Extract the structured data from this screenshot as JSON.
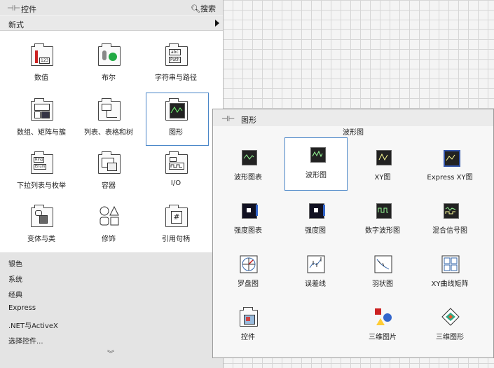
{
  "controls_palette": {
    "title": "控件",
    "search_label": "搜索",
    "subcategory": "新式",
    "tiles": [
      {
        "label": "数值",
        "icon": "numeric-icon"
      },
      {
        "label": "布尔",
        "icon": "boolean-icon"
      },
      {
        "label": "字符串与路径",
        "icon": "string-path-icon"
      },
      {
        "label": "数组、矩阵与簇",
        "icon": "array-matrix-cluster-icon"
      },
      {
        "label": "列表、表格和树",
        "icon": "list-table-tree-icon"
      },
      {
        "label": "图形",
        "icon": "graph-icon"
      },
      {
        "label": "下拉列表与枚举",
        "icon": "ring-enum-icon"
      },
      {
        "label": "容器",
        "icon": "containers-icon"
      },
      {
        "label": "I/O",
        "icon": "io-icon"
      },
      {
        "label": "变体与类",
        "icon": "variant-class-icon"
      },
      {
        "label": "修饰",
        "icon": "decorations-icon"
      },
      {
        "label": "引用句柄",
        "icon": "refnum-icon"
      }
    ],
    "icon_text": {
      "numeric": "123",
      "string_abc": "abc",
      "string_path": "Path",
      "ring": "Ring",
      "enum": "Enum",
      "refnum": "#"
    },
    "categories": [
      "银色",
      "系统",
      "经典",
      "Express",
      ".NET与ActiveX",
      "选择控件..."
    ],
    "expand_glyph": "︾"
  },
  "graph_palette": {
    "title": "图形",
    "category_label": "波形图",
    "items": [
      {
        "label": "波形图表",
        "icon": "waveform-chart-icon"
      },
      {
        "label": "波形图",
        "icon": "waveform-graph-icon"
      },
      {
        "label": "XY图",
        "icon": "xy-graph-icon"
      },
      {
        "label": "Express XY图",
        "icon": "express-xy-graph-icon"
      },
      {
        "label": "强度图表",
        "icon": "intensity-chart-icon"
      },
      {
        "label": "强度图",
        "icon": "intensity-graph-icon"
      },
      {
        "label": "数字波形图",
        "icon": "digital-waveform-graph-icon"
      },
      {
        "label": "混合信号图",
        "icon": "mixed-signal-graph-icon"
      },
      {
        "label": "罗盘图",
        "icon": "compass-plot-icon"
      },
      {
        "label": "误差线",
        "icon": "error-bar-plot-icon"
      },
      {
        "label": "羽状图",
        "icon": "feather-plot-icon"
      },
      {
        "label": "XY曲线矩阵",
        "icon": "xy-plot-matrix-icon"
      },
      {
        "label": "控件",
        "icon": "controls-folder-icon"
      },
      {
        "label": "三维图片",
        "icon": "3d-picture-icon"
      },
      {
        "label": "三维图形",
        "icon": "3d-graph-icon"
      }
    ]
  },
  "colors": {
    "selection_border": "#4a86c8",
    "palette_bg": "#f3f3f3",
    "accent_green": "#22aa44",
    "accent_red": "#cc2222"
  }
}
